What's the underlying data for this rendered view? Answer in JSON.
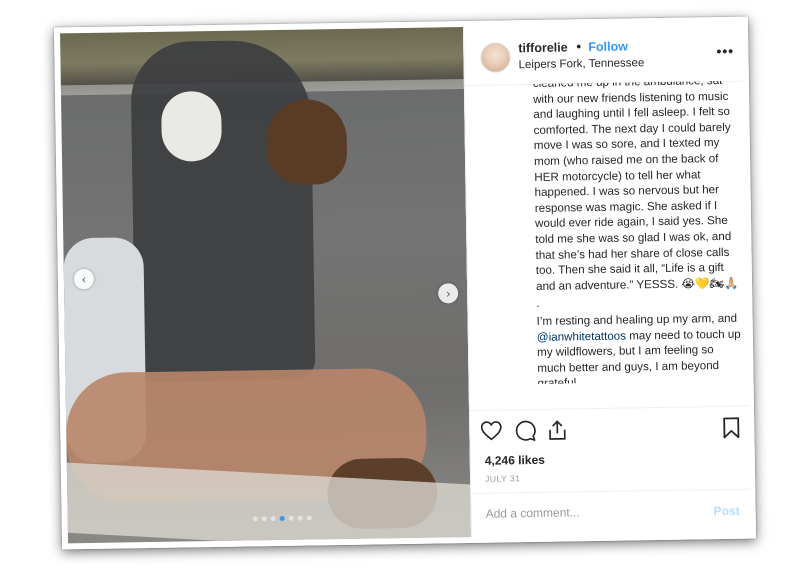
{
  "header": {
    "username": "tifforelie",
    "separator": "•",
    "follow_label": "Follow",
    "location": "Leipers Fork, Tennessee",
    "more_label": "•••"
  },
  "caption": {
    "lines_top": "cleaned me up in the ambulance, sat with our new friends listening to music and laughing until I fell asleep. I felt so comforted. The next day I could barely move I was so sore, and I texted my mom (who raised me on the back of HER motorcycle) to tell her what happened. I was so nervous but her response was magic. She asked if I would ever ride again, I said yes. She told me she was so glad I was ok, and that she’s had her share of close calls too. Then she said it all, “Life is a gift and an adventure.” YESSS. 😭💛🏍🙏🏼",
    "dot": ".",
    "para2_before": "I’m resting and healing up my arm, and ",
    "mention": "@ianwhitetattoos",
    "para2_after": " may need to touch up my wildflowers, but I am feeling so much better and guys, I am beyond grateful."
  },
  "photo": {
    "prev_arrow": "‹",
    "next_arrow": "›",
    "carousel_dots": 7,
    "active_dot": 3
  },
  "actions": {
    "heart_icon": "heart-icon",
    "comment_icon": "comment-icon",
    "share_icon": "share-icon",
    "bookmark_icon": "bookmark-icon"
  },
  "likes": "4,246 likes",
  "date": "JULY 31",
  "comment_box": {
    "placeholder": "Add a comment...",
    "post_label": "Post"
  },
  "colors": {
    "accent": "#3897f0",
    "text": "#262626",
    "muted": "#999999",
    "post_disabled": "#b2dffc"
  }
}
